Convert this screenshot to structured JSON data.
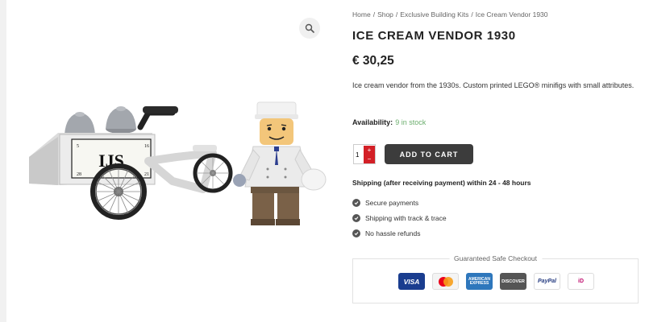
{
  "breadcrumb": {
    "items": [
      "Home",
      "Shop",
      "Exclusive Building Kits",
      "Ice Cream Vendor 1930"
    ],
    "separator": "/"
  },
  "product": {
    "title": "ICE CREAM VENDOR 1930",
    "price": "€ 30,25",
    "description": "Ice cream vendor from the 1930s. Custom printed LEGO® minifigs with small attributes.",
    "availability_label": "Availability:",
    "availability_value": "9 in stock",
    "cart_text": "IJS",
    "cart_number_tl": "5",
    "cart_number_tr": "16",
    "cart_number_bl": "28",
    "cart_number_br": "21"
  },
  "purchase": {
    "quantity": "1",
    "plus_icon": "plus-icon",
    "minus_icon": "minus-icon",
    "add_to_cart_label": "ADD TO CART"
  },
  "shipping": {
    "note": "Shipping (after receiving payment) within 24 - 48 hours",
    "features": [
      "Secure payments",
      "Shipping with track & trace",
      "No hassle refunds"
    ]
  },
  "checkout": {
    "title": "Guaranteed Safe Checkout",
    "cards": [
      {
        "name": "visa",
        "label": "VISA"
      },
      {
        "name": "mastercard",
        "label": ""
      },
      {
        "name": "american-express",
        "label": "AMERICAN EXPRESS"
      },
      {
        "name": "discover",
        "label": "DISCOVER"
      },
      {
        "name": "paypal",
        "label": "PayPal"
      },
      {
        "name": "ideal",
        "label": "iD"
      }
    ]
  },
  "colors": {
    "accent_red": "#d31f26",
    "button_dark": "#3c3c3c",
    "stock_green": "#6cae6e"
  },
  "icons": {
    "zoom": "magnifier-icon",
    "feature_check": "check-circle-icon"
  }
}
